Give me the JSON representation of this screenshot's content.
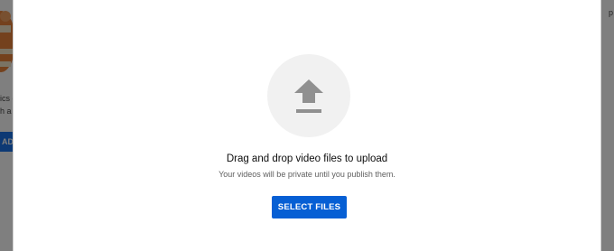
{
  "background": {
    "left_text_line1": "ics d",
    "left_text_line2": "h a",
    "left_button_label": "AD",
    "right_text": "p"
  },
  "dialog": {
    "title": "Drag and drop video files to upload",
    "subtitle": "Your videos will be private until you publish them.",
    "select_button_label": "SELECT FILES",
    "upload_icon": "upload-arrow-icon"
  },
  "colors": {
    "primary_button": "#065fd4",
    "icon_gray": "#909090",
    "circle_bg": "#f1f1f1"
  }
}
